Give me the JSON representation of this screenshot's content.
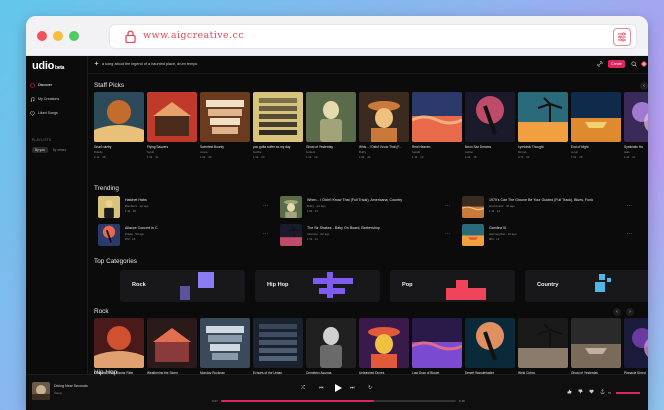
{
  "browser": {
    "url": "www.aigcreative.cc"
  },
  "app": {
    "logo": "udio",
    "logo_badge": "beta",
    "nav": [
      {
        "label": "Discover",
        "icon": "compass-icon"
      },
      {
        "label": "My Creations",
        "icon": "music-note-icon"
      },
      {
        "label": "Liked Songs",
        "icon": "heart-icon"
      }
    ],
    "playlists_label": "PLAYLISTS",
    "playlist_tabs": [
      "By you",
      "By others"
    ],
    "prompt_placeholder": "a song about the legend of a haunted place, drum tempo",
    "create_label": "Create"
  },
  "sections": {
    "staff_picks": "Staff Picks",
    "trending": "Trending",
    "top_categories": "Top Categories",
    "rock": "Rock",
    "hip_hop": "Hip Hop"
  },
  "staff_picks": [
    {
      "title": "Gnarl ruleby",
      "artist": "Ruleby",
      "likes": "2.1k",
      "plays": "48"
    },
    {
      "title": "Flying Saucers",
      "artist": "Synth",
      "likes": "1.3k",
      "plays": "31"
    },
    {
      "title": "Sweetest Bounty",
      "artist": "cocoa",
      "likes": "1.6k",
      "plays": "46"
    },
    {
      "title": "you gotta suffer as my day",
      "artist": "boldhe",
      "likes": "1.1k",
      "plays": "20"
    },
    {
      "title": "Ghost of Yesterday",
      "artist": "Gutters",
      "likes": "1.1k",
      "plays": "19"
    },
    {
      "title": "Whis... I Didn't Know That (F...",
      "artist": "Bullry",
      "likes": "1.8k",
      "plays": "44"
    },
    {
      "title": "Real Heaven",
      "artist": "Serath",
      "likes": "1.1k",
      "plays": "22"
    },
    {
      "title": "Neon Sax Dreams",
      "artist": "Aether",
      "likes": "1.0k",
      "plays": "18"
    },
    {
      "title": "Lyrebirds Thought",
      "artist": "Mirrors",
      "likes": "3.7k",
      "plays": "62"
    },
    {
      "title": "End of Night",
      "artist": "Lunar",
      "likes": "1.5k",
      "plays": "28"
    },
    {
      "title": "Symbiotic Ha",
      "artist": "Holo",
      "likes": "1.2k",
      "plays": "21"
    }
  ],
  "trending": [
    {
      "title": "Hatchet Habs",
      "artist": "Ramblers",
      "when": "1w ago",
      "likes": "1.3k",
      "plays": "18"
    },
    {
      "title": "When... I Didn't Know That (Full Track), Americana, Country",
      "artist": "Bullry",
      "when": "2w ago",
      "likes": "1.8k",
      "plays": "44"
    },
    {
      "title": "1970's Can The Groove Be Your Guided (Full Track), Blues, Funk",
      "artist": "Groovinator",
      "when": "3d ago",
      "likes": "1.1k",
      "plays": "24"
    },
    {
      "title": "Allacce Concert in C",
      "artist": "Praise",
      "when": "5d ago",
      "likes": "972",
      "plays": "15"
    },
    {
      "title": "The Sir Shakes - Baby On Board, Barbershop",
      "artist": "Velvetop",
      "when": "2w ago",
      "likes": "1.5k",
      "plays": "31"
    },
    {
      "title": "Gamline III",
      "artist": "Harmonyflow",
      "when": "3d ago",
      "likes": "906",
      "plays": "12"
    }
  ],
  "categories": [
    {
      "label": "Rock",
      "accent": "#8b7cf6"
    },
    {
      "label": "Hip Hop",
      "accent": "#7f5cf0"
    },
    {
      "label": "Pop",
      "accent": "#f0445c"
    },
    {
      "label": "Country",
      "accent": "#4fb6e8"
    }
  ],
  "rock": [
    {
      "title": "Legends of the Raptor Ride",
      "artist": "Torrex",
      "likes": "2.1k",
      "plays": "38"
    },
    {
      "title": "Weathering the Storm",
      "artist": "Holand",
      "likes": "1.6k",
      "plays": "27"
    },
    {
      "title": "Monday Rocknap",
      "artist": "Ironfist",
      "likes": "1.1k",
      "plays": "19"
    },
    {
      "title": "Echoes of the Urban",
      "artist": "Ruby",
      "likes": "1.2k",
      "plays": "22"
    },
    {
      "title": "Cemetery Asunga",
      "artist": "Velvaro",
      "likes": "1.1k",
      "plays": "18"
    },
    {
      "title": "Unleashed Dunes",
      "artist": "Mirrors",
      "likes": "1.4k",
      "plays": "26"
    },
    {
      "title": "Last Drag of Bloom",
      "artist": "Dusker",
      "likes": "1.0k",
      "plays": "15"
    },
    {
      "title": "Desert Wanderlaster",
      "artist": "Odyssey",
      "likes": "1.3k",
      "plays": "21"
    },
    {
      "title": "Weld Cobra",
      "artist": "Pterra",
      "likes": "1.2k",
      "plays": "19"
    },
    {
      "title": "Ghost of Yesterday",
      "artist": "Gutters",
      "likes": "1.1k",
      "plays": "19"
    },
    {
      "title": "Pinnacle Shred",
      "artist": "Faith",
      "likes": "1.0k",
      "plays": "14"
    }
  ],
  "player": {
    "title": "Diving Near Seconds",
    "artist": "Velvet",
    "elapsed": "0:27",
    "duration": "0:45",
    "progress": 0.65,
    "volume_label": "55"
  },
  "colors": {
    "accent": "#e0245e",
    "bg": "#0b0b0c"
  }
}
